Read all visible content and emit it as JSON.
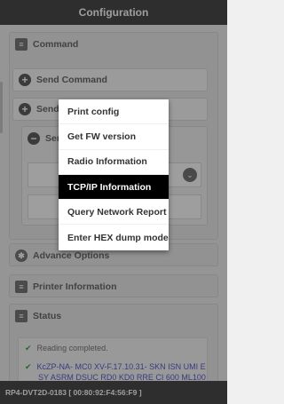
{
  "header": {
    "title": "Configuration"
  },
  "command": {
    "title": "Command",
    "items": [
      {
        "label": "Send Command"
      },
      {
        "label": "Send"
      },
      {
        "label": "Sen"
      }
    ]
  },
  "sections": {
    "advance": "Advance Options",
    "printer": "Printer Information",
    "status": "Status"
  },
  "status_lines": {
    "line1": "Reading completed.",
    "line2a": "KcZP-NA- MC0 XV-F.17.10.31- SKN ISN UMI E",
    "line2b": "SY ASRM DSUC RD0 KD0 RRE CI 600 ML100"
  },
  "context_menu": {
    "items": [
      {
        "label": "Print config"
      },
      {
        "label": "Get FW version"
      },
      {
        "label": "Radio Information"
      },
      {
        "label": "TCP/IP Information"
      },
      {
        "label": "Query Network Report"
      },
      {
        "label": "Enter HEX dump mode"
      }
    ],
    "selected": "TCP/IP Information"
  },
  "footer": {
    "device": "RP4-DVT2D-0183 [ 00:80:92:F4:56:F9 ]"
  },
  "colors": {
    "bar": "#4b4b4b",
    "check": "#39a845",
    "link": "#5b5fd0"
  }
}
